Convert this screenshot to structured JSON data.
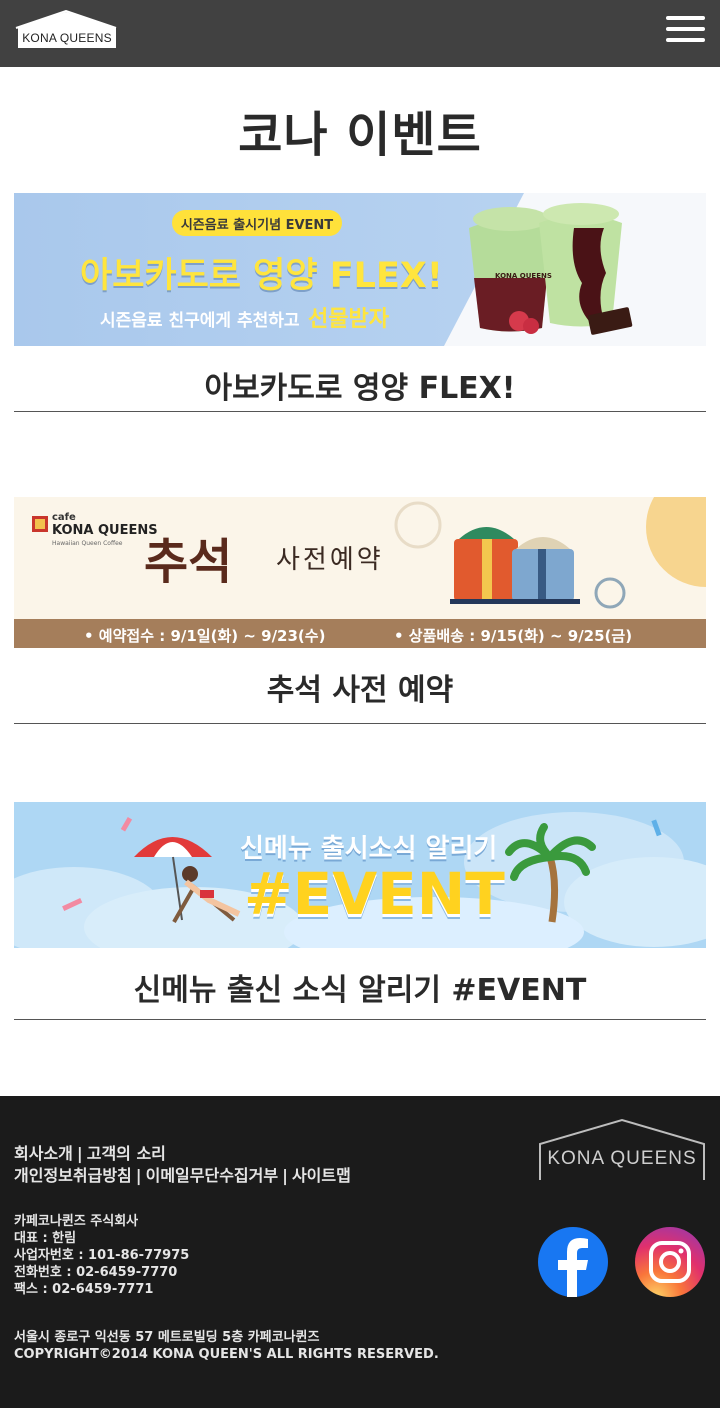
{
  "header": {
    "logo_text": "KONA QUEENS",
    "menu_icon": "hamburger-menu-icon"
  },
  "page": {
    "title": "코나 이벤트"
  },
  "events": [
    {
      "title": "아보카도로 영양 FLEX!",
      "banner": {
        "badge": "시즌음료 출시기념 EVENT",
        "headline": "아보카도로 영양 FLEX!",
        "sub": "시즌음료 친구에게 추천하고",
        "sub_highlight": "선물받자",
        "cup_label": "KONA QUEENS"
      }
    },
    {
      "title": "추석 사전 예약",
      "banner": {
        "brand_small": "cafe",
        "brand": "KONA QUEENS",
        "brand_tag": "Hawaiian Queen Coffee",
        "headline_big": "추석",
        "headline_small": "사전예약",
        "reserve_info": "• 예약접수 : 9/1일(화) ~ 9/23(수)",
        "delivery_info": "• 상품배송 : 9/15(화) ~ 9/25(금)"
      }
    },
    {
      "title": "신메뉴 출신 소식 알리기 #EVENT",
      "banner": {
        "headline": "신메뉴 출시소식 알리기",
        "hashtag": "#EVENT"
      }
    }
  ],
  "footer": {
    "links_row1": [
      "회사소개",
      "고객의 소리"
    ],
    "links_row2": [
      "개인정보취급방침",
      "이메일무단수집거부",
      "사이트맵"
    ],
    "company": "카페코나퀸즈 주식회사",
    "ceo": "대표 : 한림",
    "biz_no": "사업자번호 : 101-86-77975",
    "phone": "전화번호 : 02-6459-7770",
    "fax": "팩스 : 02-6459-7771",
    "address": "서울시 종로구 익선동 57 메트로빌딩 5층 카페코나퀸즈",
    "copyright": "COPYRIGHT©2014 KONA QUEEN'S ALL RIGHTS RESERVED.",
    "logo_text": "KONA QUEENS",
    "facebook_icon": "facebook-icon",
    "instagram_icon": "instagram-icon"
  },
  "colors": {
    "header_bg": "#414141",
    "footer_bg": "#1b1b1b",
    "facebook": "#1877f2"
  }
}
